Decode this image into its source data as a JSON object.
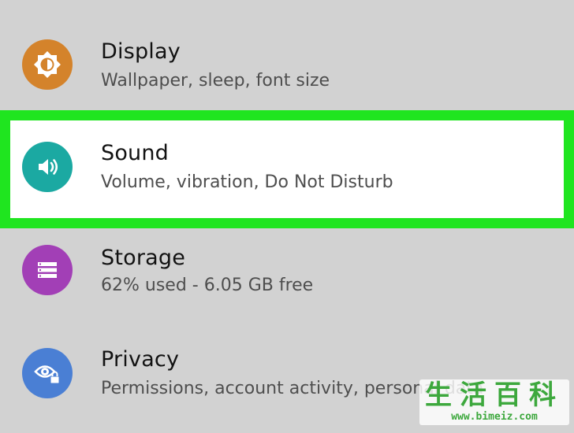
{
  "settings": {
    "items": [
      {
        "title": "Display",
        "subtitle": "Wallpaper, sleep, font size",
        "icon": "display-brightness-icon",
        "icon_color": "#d4832b"
      },
      {
        "title": "Sound",
        "subtitle": "Volume, vibration, Do Not Disturb",
        "icon": "speaker-volume-icon",
        "icon_color": "#1ba9a2",
        "highlighted": true,
        "highlight_color": "#1fe51f"
      },
      {
        "title": "Storage",
        "subtitle": "62% used - 6.05 GB free",
        "icon": "storage-list-icon",
        "icon_color": "#a23fb6"
      },
      {
        "title": "Privacy",
        "subtitle": "Permissions, account activity, personal data",
        "icon": "privacy-eye-lock-icon",
        "icon_color": "#4a7fd4"
      }
    ]
  },
  "watermark": {
    "title": "生活百科",
    "url": "www.bimeiz.com"
  },
  "colors": {
    "background": "#d2d2d2",
    "title_text": "#121212",
    "subtitle_text": "#4e4e4e"
  }
}
